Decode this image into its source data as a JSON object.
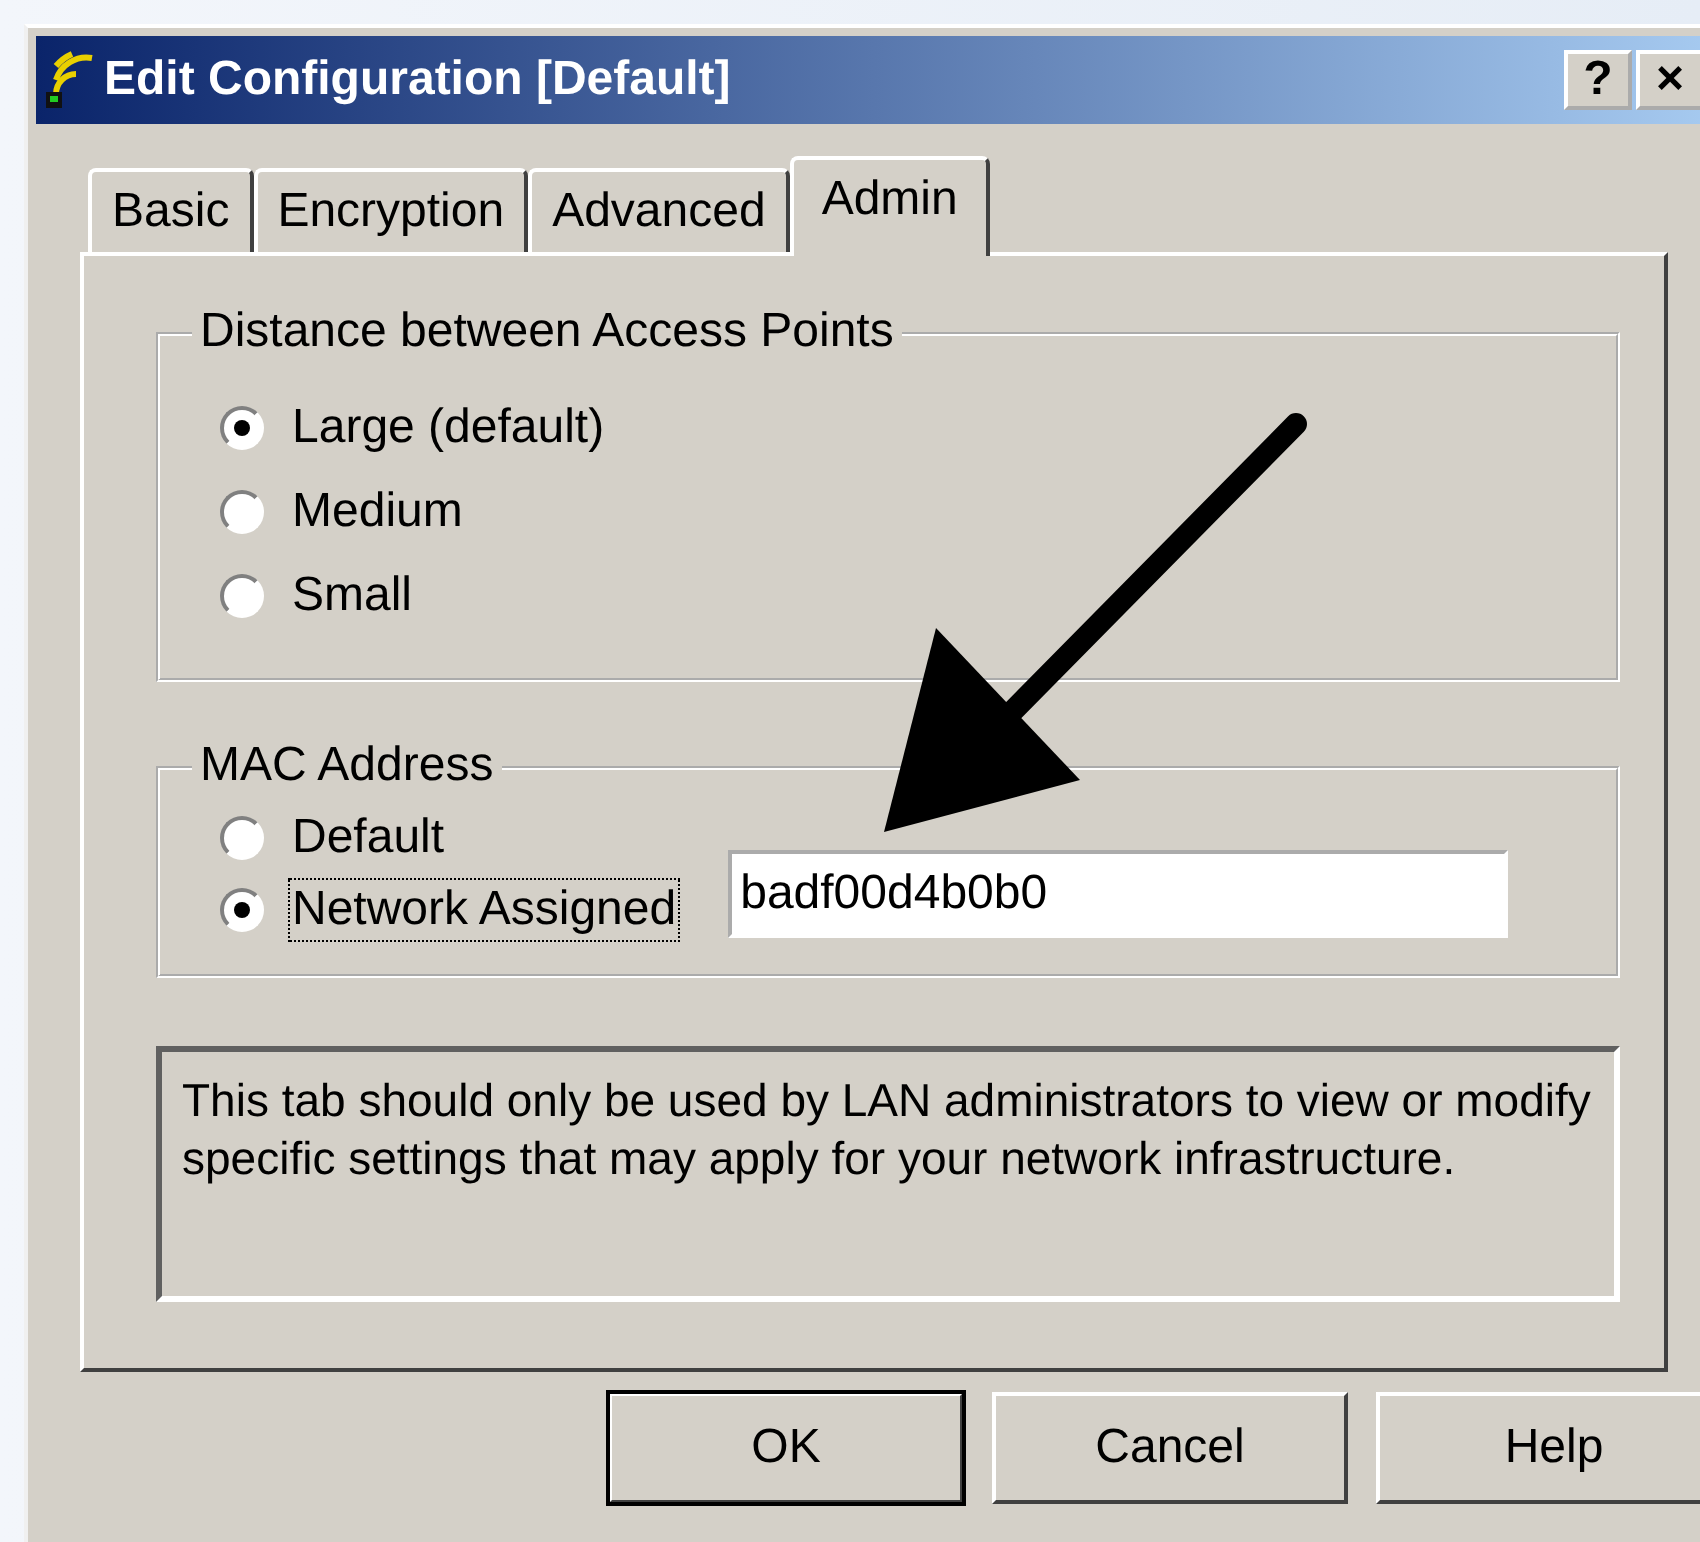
{
  "window": {
    "title": "Edit Configuration [Default]",
    "controls": [
      "?",
      "×"
    ]
  },
  "tabs": [
    {
      "label": "Basic",
      "selected": false
    },
    {
      "label": "Encryption",
      "selected": false
    },
    {
      "label": "Advanced",
      "selected": false
    },
    {
      "label": "Admin",
      "selected": true
    }
  ],
  "groups": [
    {
      "title": "Distance between Access Points",
      "options": [
        {
          "label": "Large (default)",
          "selected": true,
          "focused": false
        },
        {
          "label": "Medium",
          "selected": false,
          "focused": false
        },
        {
          "label": "Small",
          "selected": false,
          "focused": false
        }
      ]
    },
    {
      "title": "MAC Address",
      "options": [
        {
          "label": "Default",
          "selected": false,
          "focused": false
        },
        {
          "label": "Network Assigned",
          "selected": true,
          "focused": true
        }
      ],
      "field": {
        "value": "badf00d4b0b0"
      }
    }
  ],
  "info": "This tab should only be used by LAN administrators to view or modify specific settings that may apply for your network infrastructure.",
  "buttons": [
    {
      "label": "OK",
      "default": true
    },
    {
      "label": "Cancel",
      "default": false
    },
    {
      "label": "Help",
      "default": false
    }
  ]
}
